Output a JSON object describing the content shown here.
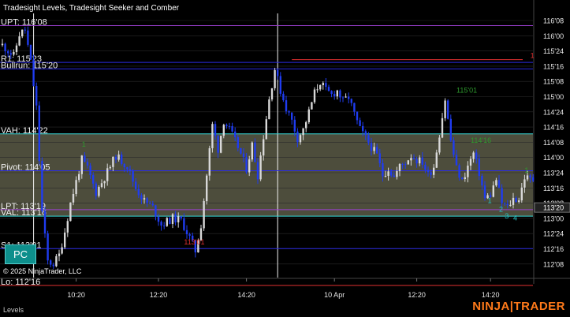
{
  "chart_data": {
    "type": "candlestick",
    "title": "Tradesight Levels, Tradesight Seeker and Comber",
    "copyright": "© 2025 NinjaTrader, LLC",
    "price_axis": {
      "ticks": [
        "116'08",
        "116'00",
        "115'24",
        "115'16",
        "115'08",
        "115'00",
        "114'24",
        "114'16",
        "114'08",
        "114'00",
        "113'24",
        "113'16",
        "113'08",
        "113'00",
        "112'24",
        "112'16",
        "112'08"
      ],
      "min_ticks": 3604,
      "max_ticks": 3726,
      "current_price_label": "113'20",
      "current_price_ticks": 3636
    },
    "time_axis": {
      "labels": [
        "10:20",
        "12:20",
        "14:20",
        "10 Apr",
        "12:20",
        "14:20"
      ],
      "label_bar_index": [
        26,
        55,
        86,
        117,
        146,
        172
      ]
    },
    "levels": [
      {
        "name": "UPT: 116'08",
        "ticks": 3720,
        "color": "#9b3fd0"
      },
      {
        "name": "R1: 115'23",
        "ticks": 3703,
        "color": "#2a2ae0"
      },
      {
        "name": "Bullrun: 115'20",
        "ticks": 3700,
        "color": "#2a2ae0"
      },
      {
        "name": "VAH: 114'22",
        "ticks": 3670,
        "color": "#38d8d8"
      },
      {
        "name": "Pivot: 114'05",
        "ticks": 3653,
        "color": "#2a2ae0"
      },
      {
        "name": "LPT: 113'19",
        "ticks": 3635,
        "color": "#9b3fd0"
      },
      {
        "name": "VAL: 113'16",
        "ticks": 3632,
        "color": "#38d8d8"
      },
      {
        "name": "S1: 113'01",
        "ticks": 3617,
        "color": "#2a2ae0"
      },
      {
        "name": "Lo: 112'16",
        "ticks": 3600,
        "color": "#e03030"
      }
    ],
    "value_area": {
      "high_ticks": 3670,
      "low_ticks": 3632,
      "color": "#5a5a46"
    },
    "annotations": [
      {
        "text": "1",
        "color": "#e03030",
        "bar": 186,
        "ticks": 3705
      },
      {
        "text": "115'01",
        "color": "#2e9a2e",
        "bar": 160,
        "ticks": 3689
      },
      {
        "text": "114'16",
        "color": "#2e9a2e",
        "bar": 165,
        "ticks": 3666
      },
      {
        "text": "113'01",
        "color": "#e03030",
        "bar": 64,
        "ticks": 3619
      },
      {
        "text": "1",
        "color": "#25c8c8",
        "bar": 171,
        "ticks": 3638
      },
      {
        "text": "2",
        "color": "#25c8c8",
        "bar": 175,
        "ticks": 3634
      },
      {
        "text": "3",
        "color": "#25c8c8",
        "bar": 177,
        "ticks": 3631
      },
      {
        "text": "4",
        "color": "#25c8c8",
        "bar": 180,
        "ticks": 3630
      },
      {
        "text": "1",
        "color": "#2e9a2e",
        "bar": 184,
        "ticks": 3652
      },
      {
        "text": "1",
        "color": "#2e9a2e",
        "bar": 28,
        "ticks": 3664
      }
    ],
    "anchors": [
      [
        0,
        3711
      ],
      [
        4,
        3706
      ],
      [
        6,
        3716
      ],
      [
        8,
        3718
      ],
      [
        10,
        3703
      ],
      [
        12,
        3682
      ],
      [
        14,
        3634
      ],
      [
        16,
        3611
      ],
      [
        18,
        3610
      ],
      [
        20,
        3614
      ],
      [
        22,
        3625
      ],
      [
        24,
        3638
      ],
      [
        26,
        3648
      ],
      [
        28,
        3658
      ],
      [
        30,
        3654
      ],
      [
        33,
        3643
      ],
      [
        36,
        3650
      ],
      [
        40,
        3660
      ],
      [
        44,
        3655
      ],
      [
        47,
        3645
      ],
      [
        50,
        3639
      ],
      [
        53,
        3636
      ],
      [
        56,
        3628
      ],
      [
        60,
        3631
      ],
      [
        63,
        3630
      ],
      [
        66,
        3622
      ],
      [
        68,
        3616
      ],
      [
        70,
        3628
      ],
      [
        72,
        3651
      ],
      [
        74,
        3674
      ],
      [
        76,
        3663
      ],
      [
        78,
        3676
      ],
      [
        80,
        3672
      ],
      [
        83,
        3664
      ],
      [
        86,
        3654
      ],
      [
        88,
        3665
      ],
      [
        90,
        3651
      ],
      [
        92,
        3669
      ],
      [
        94,
        3686
      ],
      [
        96,
        3700
      ],
      [
        98,
        3690
      ],
      [
        100,
        3682
      ],
      [
        102,
        3676
      ],
      [
        104,
        3668
      ],
      [
        106,
        3672
      ],
      [
        108,
        3680
      ],
      [
        110,
        3689
      ],
      [
        112,
        3694
      ],
      [
        114,
        3690
      ],
      [
        116,
        3688
      ],
      [
        118,
        3690
      ],
      [
        120,
        3685
      ],
      [
        122,
        3687
      ],
      [
        124,
        3679
      ],
      [
        126,
        3672
      ],
      [
        128,
        3668
      ],
      [
        130,
        3664
      ],
      [
        132,
        3660
      ],
      [
        134,
        3651
      ],
      [
        136,
        3654
      ],
      [
        138,
        3650
      ],
      [
        140,
        3655
      ],
      [
        142,
        3657
      ],
      [
        144,
        3660
      ],
      [
        146,
        3658
      ],
      [
        148,
        3657
      ],
      [
        150,
        3651
      ],
      [
        152,
        3655
      ],
      [
        154,
        3670
      ],
      [
        156,
        3686
      ],
      [
        158,
        3667
      ],
      [
        160,
        3654
      ],
      [
        162,
        3648
      ],
      [
        164,
        3655
      ],
      [
        166,
        3661
      ],
      [
        168,
        3652
      ],
      [
        170,
        3640
      ],
      [
        172,
        3642
      ],
      [
        174,
        3649
      ],
      [
        176,
        3638
      ],
      [
        178,
        3636
      ],
      [
        180,
        3640
      ],
      [
        182,
        3640
      ],
      [
        184,
        3650
      ],
      [
        186,
        3649
      ]
    ],
    "grid": true
  },
  "ui": {
    "pc_button": "PC",
    "status_text": "Levels",
    "logo_left": "NINJA",
    "logo_right": "TRADER"
  }
}
